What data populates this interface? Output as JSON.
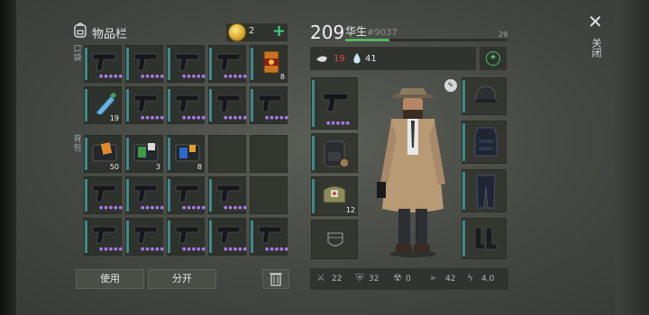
{
  "inventory": {
    "title": "物品栏",
    "coins": "2",
    "add_symbol": "+",
    "pocket_label": "口袋",
    "backpack_label": "背包",
    "rows": [
      [
        {
          "item": "pistol",
          "rarity": 5
        },
        {
          "item": "pistol",
          "rarity": 5
        },
        {
          "item": "pistol",
          "rarity": 5
        },
        {
          "item": "pistol",
          "rarity": 5
        },
        {
          "item": "canned-food",
          "qty": "8"
        }
      ],
      [
        {
          "item": "water-bottle",
          "qty": "19"
        },
        {
          "item": "pistol",
          "rarity": 5
        },
        {
          "item": "pistol",
          "rarity": 5
        },
        {
          "item": "pistol",
          "rarity": 5
        },
        {
          "item": "pistol",
          "rarity": 5
        }
      ],
      [
        {
          "item": "wallet-orange",
          "qty": "50"
        },
        {
          "item": "wallet-green",
          "qty": "3"
        },
        {
          "item": "wallet-blue",
          "qty": "8"
        },
        {
          "item": "empty"
        },
        {
          "item": "empty"
        }
      ],
      [
        {
          "item": "pistol",
          "rarity": 5
        },
        {
          "item": "pistol",
          "rarity": 5
        },
        {
          "item": "pistol",
          "rarity": 5
        },
        {
          "item": "pistol",
          "rarity": 5
        },
        {
          "item": "empty"
        }
      ],
      [
        {
          "item": "pistol",
          "rarity": 5
        },
        {
          "item": "pistol",
          "rarity": 5
        },
        {
          "item": "pistol",
          "rarity": 5
        },
        {
          "item": "pistol",
          "rarity": 5
        },
        {
          "item": "pistol",
          "rarity": 5
        }
      ]
    ]
  },
  "actions": {
    "use": "使用",
    "split": "分开"
  },
  "player": {
    "level": "209",
    "name": "华生",
    "id": "#9037",
    "next_level": "29",
    "xp_progress": 0.27,
    "hunger": "19",
    "thirst": "41",
    "status_symbol": "★"
  },
  "equipment": {
    "medkit_qty": "12"
  },
  "combat": {
    "attack": "22",
    "armor": "32",
    "radiation": "0",
    "speed": "42",
    "stealth": "4.0"
  },
  "close": {
    "symbol": "✕",
    "label": "关闭"
  },
  "colors": {
    "accent_teal": "#3e8a8a",
    "rarity_purple": "#a878e8",
    "xp_green": "#57b45a",
    "hunger_red": "#e04a4a"
  }
}
